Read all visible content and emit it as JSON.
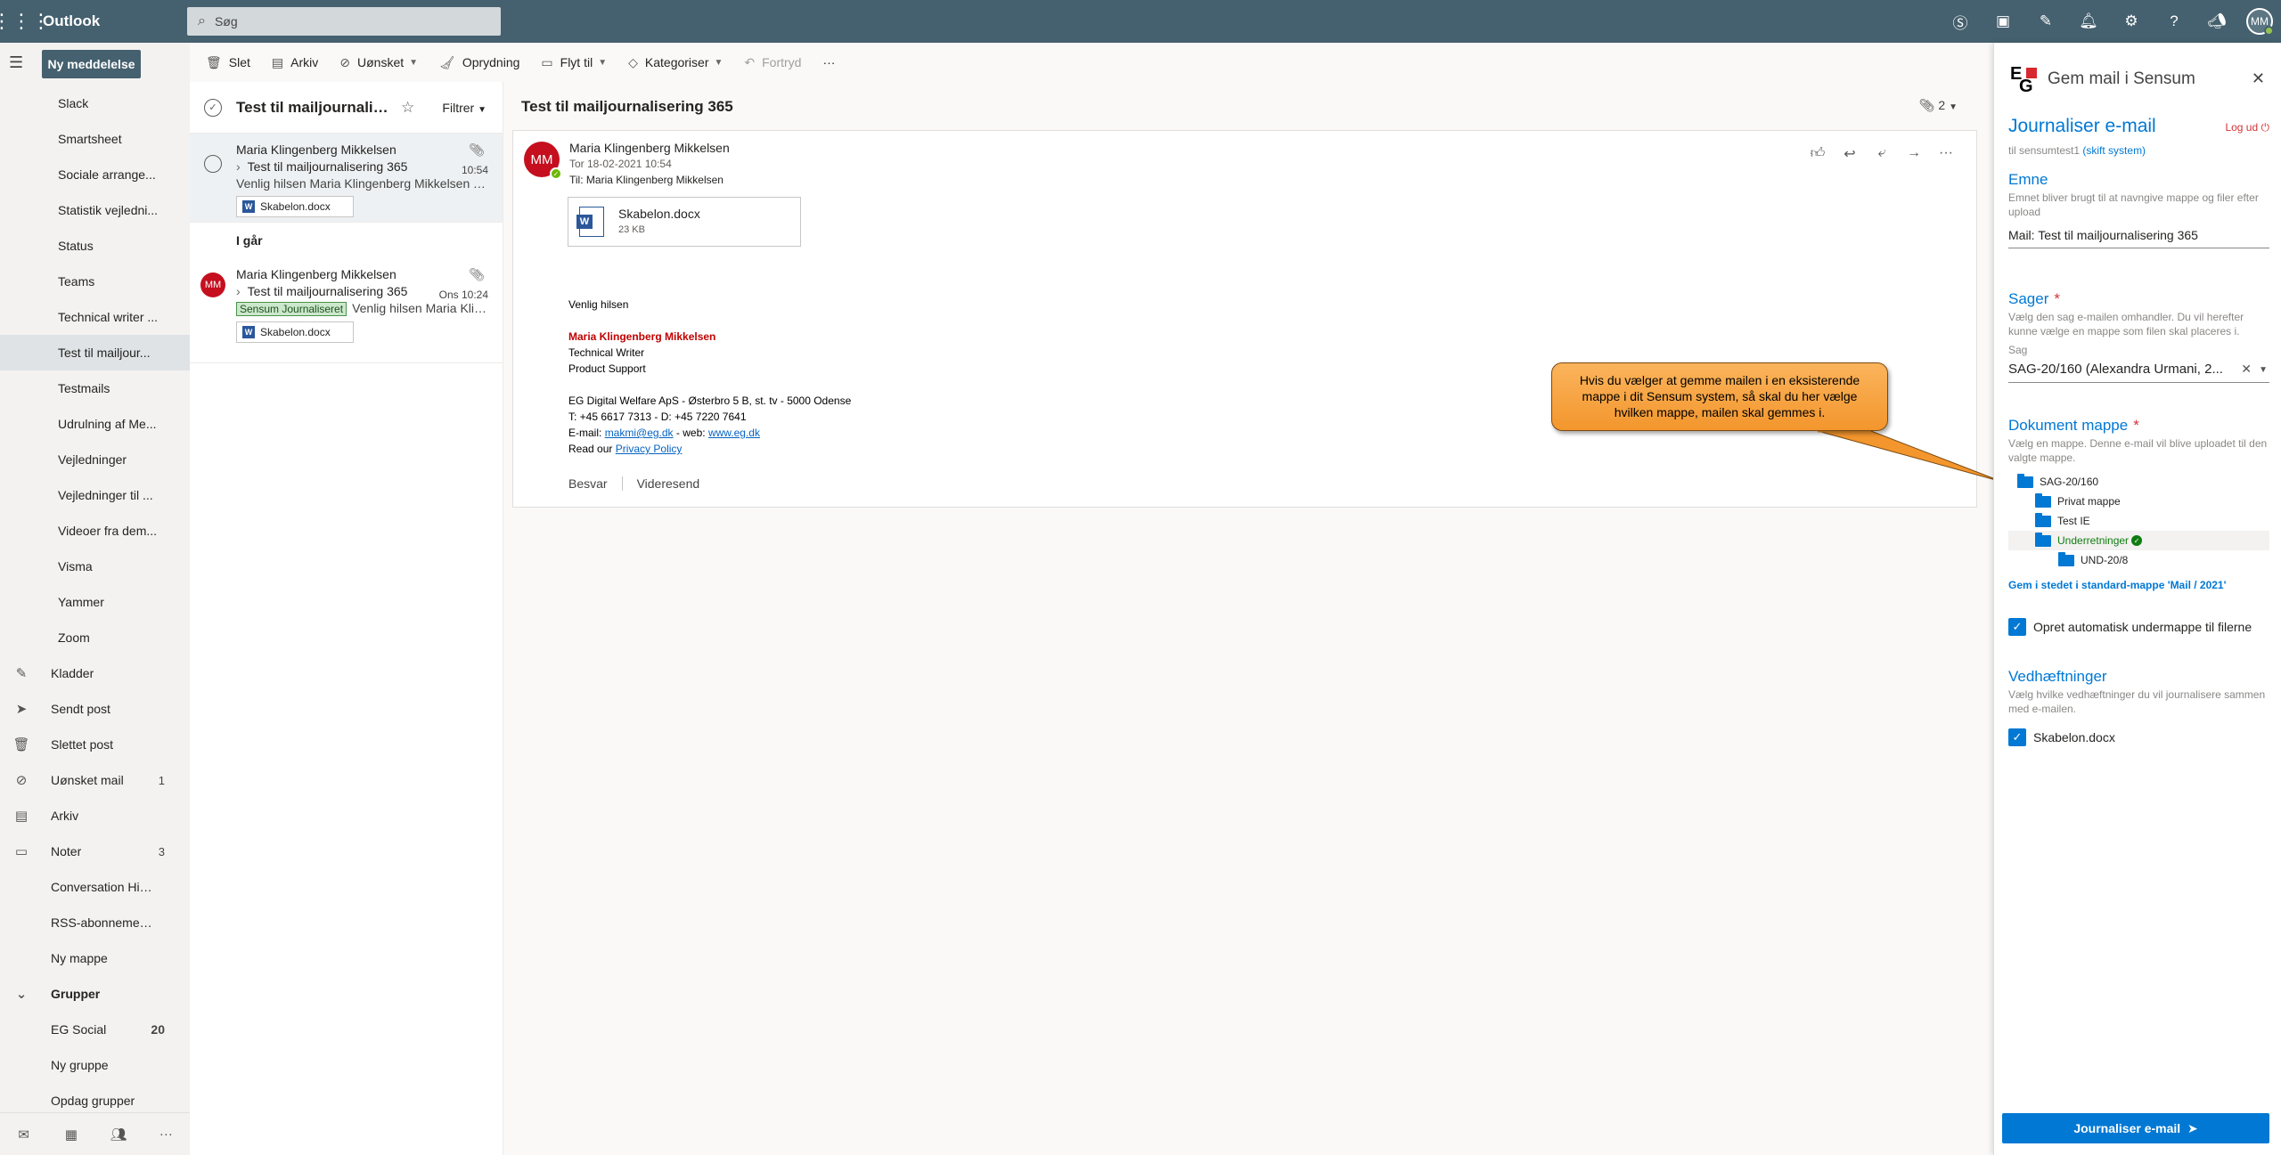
{
  "app": {
    "brand": "Outlook",
    "search_placeholder": "Søg",
    "user_initials": "MM"
  },
  "colors": {
    "topbar": "#45606e",
    "accent": "#0078d4",
    "avatar_red": "#c50f1f",
    "callout_orange": "#f3962d"
  },
  "nav": {
    "new_message": "Ny meddelelse",
    "folders": [
      {
        "label": "Slack",
        "type": "sub"
      },
      {
        "label": "Smartsheet",
        "type": "sub"
      },
      {
        "label": "Sociale arrange...",
        "type": "sub"
      },
      {
        "label": "Statistik vejledni...",
        "type": "sub"
      },
      {
        "label": "Status",
        "type": "sub"
      },
      {
        "label": "Teams",
        "type": "sub"
      },
      {
        "label": "Technical writer ...",
        "type": "sub"
      },
      {
        "label": "Test til mailjour...",
        "type": "sub",
        "selected": true
      },
      {
        "label": "Testmails",
        "type": "sub"
      },
      {
        "label": "Udrulning af Me...",
        "type": "sub"
      },
      {
        "label": "Vejledninger",
        "type": "sub"
      },
      {
        "label": "Vejledninger til ...",
        "type": "sub"
      },
      {
        "label": "Videoer fra dem...",
        "type": "sub"
      },
      {
        "label": "Visma",
        "type": "sub"
      },
      {
        "label": "Yammer",
        "type": "sub"
      },
      {
        "label": "Zoom",
        "type": "sub"
      },
      {
        "label": "Kladder",
        "type": "top",
        "icon": "pencil-icon"
      },
      {
        "label": "Sendt post",
        "type": "top",
        "icon": "send-icon"
      },
      {
        "label": "Slettet post",
        "type": "top",
        "icon": "trash-icon"
      },
      {
        "label": "Uønsket mail",
        "type": "top",
        "icon": "block-icon",
        "count": "1"
      },
      {
        "label": "Arkiv",
        "type": "top",
        "icon": "archive-icon"
      },
      {
        "label": "Noter",
        "type": "top",
        "icon": "note-icon",
        "count": "3"
      },
      {
        "label": "Conversation Hist...",
        "type": "top"
      },
      {
        "label": "RSS-abonnementer",
        "type": "top"
      },
      {
        "label": "Ny mappe",
        "type": "top"
      },
      {
        "label": "Grupper",
        "type": "group"
      },
      {
        "label": "EG Social",
        "type": "top",
        "count": "20",
        "bold": true
      },
      {
        "label": "Ny gruppe",
        "type": "top"
      },
      {
        "label": "Opdag grupper",
        "type": "top"
      }
    ]
  },
  "commands": {
    "delete": "Slet",
    "archive": "Arkiv",
    "junk": "Uønsket",
    "sweep": "Oprydning",
    "move": "Flyt til",
    "categories": "Kategoriser",
    "undo": "Fortryd",
    "more": "···"
  },
  "list": {
    "title": "Test til mailjournalisering 365",
    "filter": "Filtrer",
    "date_group": "I går",
    "messages": [
      {
        "sender": "Maria Klingenberg Mikkelsen",
        "subject": "Test til mailjournalisering 365",
        "time": "10:54",
        "preview": "Venlig hilsen Maria Klingenberg Mikkelsen Technical Writer",
        "attachment": "Skabelon.docx"
      },
      {
        "avatar": "MM",
        "sender": "Maria Klingenberg Mikkelsen",
        "subject": "Test til mailjournalisering 365",
        "time": "Ons 10:24",
        "tag": "Sensum Journaliseret",
        "preview": "Venlig hilsen Maria Klingenberg Mikkelsen",
        "attachment": "Skabelon.docx"
      }
    ]
  },
  "reading": {
    "title": "Test til mailjournalisering 365",
    "attachment_count": "2",
    "avatar": "MM",
    "from": "Maria Klingenberg Mikkelsen",
    "date": "Tor 18-02-2021 10:54",
    "to_label": "Til:",
    "to": "Maria Klingenberg Mikkelsen",
    "attachment_name": "Skabelon.docx",
    "attachment_size": "23 KB",
    "body": {
      "greeting": "Venlig hilsen",
      "name": "Maria Klingenberg Mikkelsen",
      "role": "Technical Writer",
      "dept": "Product Support",
      "company": "EG Digital Welfare ApS - Østerbro 5 B, st. tv - 5000 Odense",
      "phone": "T: +45 6617 7313 - D: +45 7220 7641",
      "email_prefix": "E-mail:",
      "email": "makmi@eg.dk",
      "web_prefix": "- web:",
      "web": "www.eg.dk",
      "privacy_prefix": "Read our",
      "privacy": "Privacy Policy"
    },
    "reply": "Besvar",
    "forward": "Videresend"
  },
  "callout": {
    "text": "Hvis du vælger at gemme mailen i en eksisterende mappe i dit Sensum system, så skal du her vælge hvilken mappe, mailen skal gemmes i."
  },
  "addin": {
    "title": "Gem mail i Sensum",
    "heading": "Journaliser e-mail",
    "logout": "Log ud",
    "system_prefix": "til sensumtest1",
    "system_link": "(skift system)",
    "subject_label": "Emne",
    "subject_desc": "Emnet bliver brugt til at navngive mappe og filer efter upload",
    "subject_value": "Mail: Test til mailjournalisering 365",
    "case_label": "Sager",
    "case_desc": "Vælg den sag e-mailen omhandler. Du vil herefter kunne vælge en mappe som filen skal placeres i.",
    "case_field_label": "Sag",
    "case_value": "SAG-20/160 (Alexandra Urmani, 2...",
    "docfolder_label": "Dokument mappe",
    "docfolder_desc": "Vælg en mappe. Denne e-mail vil blive uploadet til den valgte mappe.",
    "tree": [
      {
        "label": "SAG-20/160",
        "level": 0
      },
      {
        "label": "Privat mappe",
        "level": 1
      },
      {
        "label": "Test IE",
        "level": 1
      },
      {
        "label": "Underretninger",
        "level": 1,
        "selected": true
      },
      {
        "label": "UND-20/8",
        "level": 2
      }
    ],
    "std_link": "Gem i stedet i standard-mappe 'Mail / 2021'",
    "auto_subfolder": "Opret automatisk undermappe til filerne",
    "attachments_label": "Vedhæftninger",
    "attachments_desc": "Vælg hvilke vedhæftninger du vil journalisere sammen med e-mailen.",
    "attachment_item": "Skabelon.docx",
    "submit": "Journaliser e-mail"
  }
}
